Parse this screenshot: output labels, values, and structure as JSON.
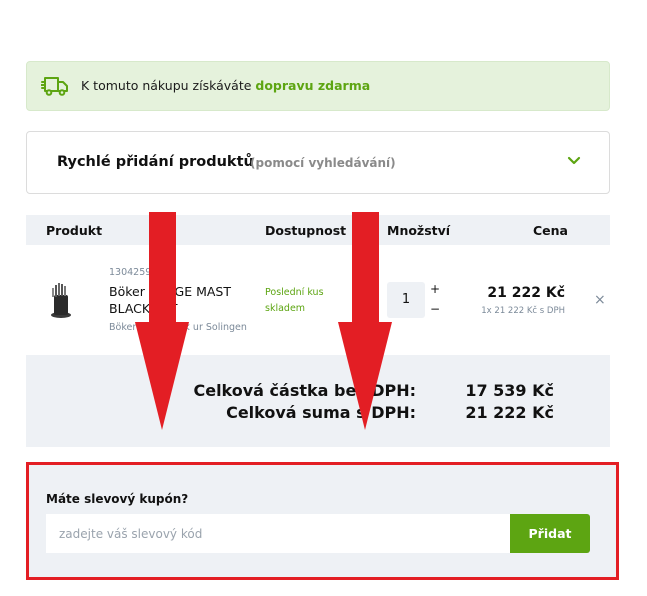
{
  "shipping": {
    "text": "K tomuto nákupu získáváte ",
    "highlight": "dopravu zdarma",
    "icon": "truck-icon"
  },
  "quick_add": {
    "title": "Rychlé přidání produktů",
    "subtitle": "(pomocí vyhledávání)",
    "icon": "chevron-down-icon"
  },
  "table": {
    "headers": [
      "Produkt",
      "Dostupnost",
      "Množství",
      "Cena"
    ]
  },
  "product": {
    "code": "1304259",
    "name_line1": "Böker FORGE MAST",
    "name_line2": "BLACK SET",
    "brand": "Böker Baumwerk ur Solingen",
    "availability_line1": "Poslední kus",
    "availability_line2": "skladem",
    "quantity": "1",
    "plus": "+",
    "minus": "−",
    "price": "21 222 Kč",
    "price_detail": "1x 21 222 Kč s DPH",
    "remove": "×"
  },
  "totals": {
    "without_vat_label": "Celková částka bez DPH:",
    "without_vat_value": "17 539 Kč",
    "with_vat_label": "Celková suma s DPH:",
    "with_vat_value": "21 222 Kč"
  },
  "coupon": {
    "label": "Máte slevový kupón?",
    "placeholder": "zadejte váš slevový kód",
    "button": "Přidat"
  },
  "colors": {
    "accent_green": "#5da512",
    "highlight_red": "#e31e24",
    "panel_grey": "#eef1f5"
  }
}
